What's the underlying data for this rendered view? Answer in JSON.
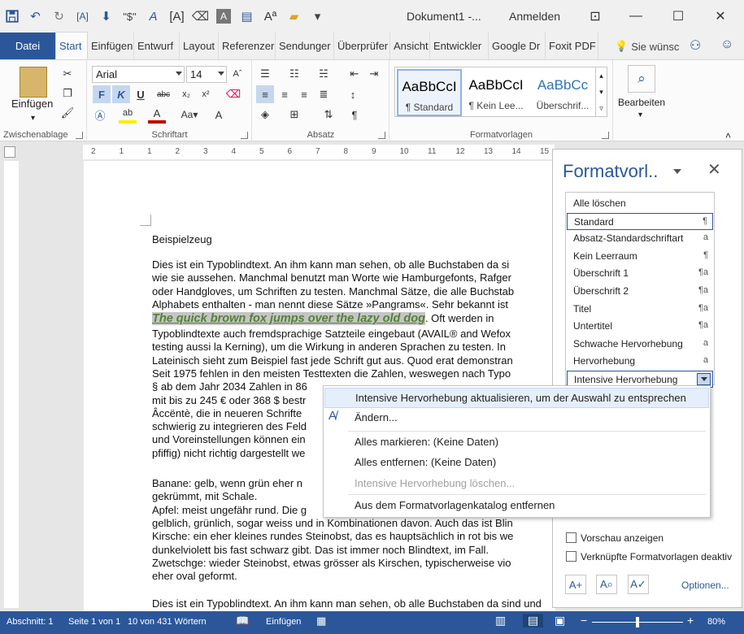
{
  "title": {
    "document": "Dokument1 -...",
    "signin": "Anmelden"
  },
  "tabs": [
    "Datei",
    "Start",
    "Einfügen",
    "Entwurf",
    "Layout",
    "Referenzer",
    "Sendunger",
    "Überprüfer",
    "Ansicht",
    "Entwickler",
    "Google Dr",
    "Foxit PDF"
  ],
  "tellme": "Sie wünsc",
  "ribbon": {
    "clipboard": {
      "paste": "Einfügen",
      "label": "Zwischenablage"
    },
    "font": {
      "name": "Arial",
      "size": "14",
      "label": "Schriftart",
      "bold": "F",
      "italic": "K",
      "underline": "U",
      "strike": "abc"
    },
    "paragraph": {
      "label": "Absatz"
    },
    "styles": {
      "label": "Formatvorlagen",
      "items": [
        {
          "preview": "AaBbCcI",
          "name": "¶ Standard"
        },
        {
          "preview": "AaBbCcI",
          "name": "¶ Kein Lee..."
        },
        {
          "preview": "AaBbCc",
          "name": "Überschrif..."
        }
      ]
    },
    "edit": {
      "label": "Bearbeiten"
    }
  },
  "doc": {
    "heading": "Beispielzeug",
    "lines": [
      "Dies ist ein Typoblindtext. An ihm kann man sehen, ob alle Buchstaben da si",
      "wie sie aussehen. Manchmal benutzt man Worte wie Hamburgefonts, Rafger",
      "oder Handgloves, um Schriften zu testen. Manchmal Sätze, die alle Buchstab",
      "Alphabets enthalten - man nennt diese Sätze »Pangrams«. Sehr bekannt ist"
    ],
    "intense": "The quick brown fox jumps over the lazy old dog",
    "intense_after": ". Oft werden in",
    "lines2": [
      "Typoblindtexte auch fremdsprachige Satzteile eingebaut (AVAIL® and Wefox",
      "testing aussi la Kerning), um die Wirkung in anderen Sprachen zu testen. In",
      "Lateinisch sieht zum Beispiel fast jede Schrift gut aus. Quod erat demonstran",
      "Seit 1975 fehlen in den meisten Testtexten die Zahlen, weswegen nach Typo",
      "§ ab dem Jahr 2034 Zahlen in 86",
      "mit bis zu 245 € oder 368 $ bestr",
      "Âccëntè, die in neueren Schrifte",
      "schwierig zu integrieren des Feld",
      "und Voreinstellungen können ein",
      "pfiffig) nicht richtig dargestellt we"
    ],
    "lines3": [
      "Banane: gelb, wenn grün eher n",
      "gekrümmt, mit Schale.",
      "Apfel: meist ungefähr rund. Die g",
      "gelblich, grünlich, sogar weiss und in Kombinationen davon. Auch das ist Blin",
      "Kirsche: ein eher kleines rundes Steinobst, das es hauptsächlich in rot bis we",
      "dunkelviolett bis fast schwarz gibt. Das ist immer noch Blindtext, im Fall.",
      "Zwetschge: wieder Steinobst, etwas grösser als Kirschen, typischerweise vio",
      "eher oval geformt."
    ],
    "last": "Dies ist ein Typoblindtext. An ihm kann man sehen, ob alle Buchstaben da sind und"
  },
  "pane": {
    "title": "Formatvorl..",
    "styles": [
      {
        "name": "Alle löschen",
        "mark": ""
      },
      {
        "name": "Standard",
        "mark": "¶"
      },
      {
        "name": "Absatz-Standardschriftart",
        "mark": "a"
      },
      {
        "name": "Kein Leerraum",
        "mark": "¶"
      },
      {
        "name": "Überschrift 1",
        "mark": "¶a"
      },
      {
        "name": "Überschrift 2",
        "mark": "¶a"
      },
      {
        "name": "Titel",
        "mark": "¶a"
      },
      {
        "name": "Untertitel",
        "mark": "¶a"
      },
      {
        "name": "Schwache Hervorhebung",
        "mark": "a"
      },
      {
        "name": "Hervorhebung",
        "mark": "a"
      },
      {
        "name": "Intensive Hervorhebung",
        "mark": ""
      }
    ],
    "preview": "Vorschau anzeigen",
    "linked": "Verknüpfte Formatvorlagen deaktiv",
    "options": "Optionen..."
  },
  "menu": [
    "Intensive Hervorhebung aktualisieren, um der Auswahl zu entsprechen",
    "Ändern...",
    "Alles markieren: (Keine Daten)",
    "Alles entfernen: (Keine Daten)",
    "Intensive Hervorhebung löschen...",
    "Aus dem Formatvorlagenkatalog entfernen"
  ],
  "status": {
    "section": "Abschnitt: 1",
    "page": "Seite 1 von 1",
    "words": "10 von 431 Wörtern",
    "mode": "Einfügen",
    "zoom": "80%",
    "zoom_level": 0.5
  },
  "ruler_numbers": [
    "2",
    "1",
    "1",
    "2",
    "3",
    "4",
    "5",
    "6",
    "7",
    "8",
    "9",
    "10",
    "11",
    "12",
    "13",
    "14",
    "15"
  ]
}
